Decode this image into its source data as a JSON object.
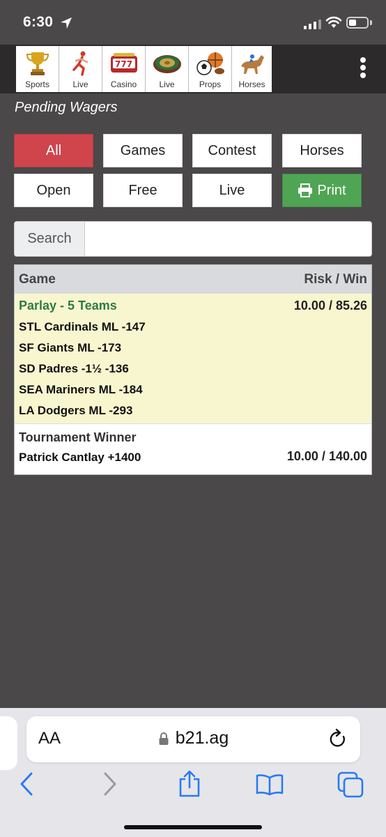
{
  "status": {
    "time": "6:30"
  },
  "nav": {
    "tiles": [
      {
        "label": "Sports",
        "icon": "trophy-icon"
      },
      {
        "label": "Live",
        "icon": "runner-icon"
      },
      {
        "label": "Casino",
        "icon": "slot-machine-icon"
      },
      {
        "label": "Live",
        "icon": "roulette-icon"
      },
      {
        "label": "Props",
        "icon": "sports-balls-icon"
      },
      {
        "label": "Horses",
        "icon": "horse-racing-icon"
      }
    ]
  },
  "page": {
    "title": "Pending Wagers"
  },
  "filters": {
    "all": "All",
    "games": "Games",
    "contest": "Contest",
    "horses": "Horses",
    "open": "Open",
    "free": "Free",
    "live": "Live",
    "print": "Print",
    "colors": {
      "active": "#d0454c",
      "print": "#4fa554"
    }
  },
  "search": {
    "label": "Search",
    "value": ""
  },
  "table": {
    "headers": {
      "game": "Game",
      "risk_win": "Risk / Win"
    },
    "wagers": [
      {
        "title": "Parlay - 5 Teams",
        "risk_win": "10.00 / 85.26",
        "legs": [
          "STL Cardinals ML -147",
          "SF Giants ML -173",
          "SD Padres -1½ -136",
          "SEA Mariners ML -184",
          "LA Dodgers ML -293"
        ]
      },
      {
        "title": "Tournament Winner",
        "pick": "Patrick Cantlay +1400",
        "risk_win": "10.00 / 140.00"
      }
    ]
  },
  "browser": {
    "aa": "AA",
    "url": "b21.ag"
  }
}
